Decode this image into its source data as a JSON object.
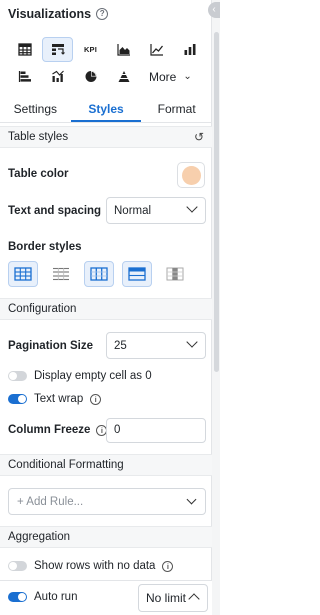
{
  "header": {
    "title": "Visualizations",
    "help_icon": "question-circle-icon"
  },
  "viz_types": {
    "row1": [
      "table-icon",
      "pivot-table-icon",
      "kpi-icon",
      "area-chart-icon",
      "line-chart-icon",
      "bar-chart-icon"
    ],
    "row2": [
      "horizontal-bar-icon",
      "combo-chart-icon",
      "pie-chart-icon",
      "funnel-icon"
    ],
    "kpi_label": "KPI",
    "more_label": "More",
    "active_index": 1
  },
  "tabs": [
    "Settings",
    "Styles",
    "Format"
  ],
  "active_tab": "Styles",
  "accent_color": "#1a6fd1",
  "table_styles": {
    "section_title": "Table styles",
    "table_color_label": "Table color",
    "table_color_value": "#f7cfad",
    "text_spacing_label": "Text and spacing",
    "text_spacing_value": "Normal",
    "border_styles_label": "Border styles"
  },
  "configuration": {
    "section_title": "Configuration",
    "pagination_label": "Pagination Size",
    "pagination_value": "25",
    "display_empty_label": "Display empty cell as 0",
    "display_empty_on": false,
    "text_wrap_label": "Text wrap",
    "text_wrap_on": true,
    "column_freeze_label": "Column Freeze",
    "column_freeze_value": "0"
  },
  "conditional_formatting": {
    "section_title": "Conditional Formatting",
    "add_rule_label": "+ Add Rule..."
  },
  "aggregation": {
    "section_title": "Aggregation",
    "show_rows_label": "Show rows with no data",
    "show_rows_on": false
  },
  "footer": {
    "auto_run_label": "Auto run",
    "auto_run_on": true,
    "limit_value": "No limit"
  }
}
